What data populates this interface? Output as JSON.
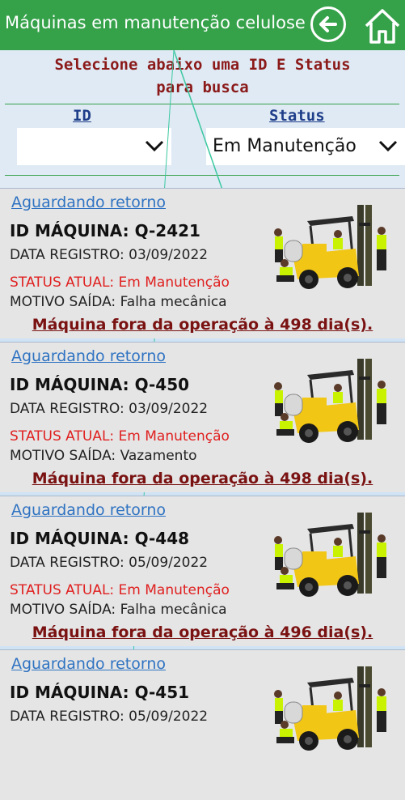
{
  "header": {
    "title": "Máquinas em manutenção celulose"
  },
  "filters": {
    "prompt_line1": "Selecione abaixo uma ID E Status",
    "prompt_line2": "para busca",
    "id_label": "ID",
    "status_label": "Status",
    "id_value": "",
    "status_value": "Em Manutenção"
  },
  "cards": [
    {
      "waiting": "Aguardando retorno",
      "machine_id": "ID MÁQUINA: Q-2421",
      "date": "DATA REGISTRO: 03/09/2022",
      "status": "STATUS ATUAL: Em Manutenção",
      "motivo_label": "MOTIVO SAÍDA: ",
      "motivo_value": "Falha mecânica",
      "days": "Máquina fora da operação à 498 dia(s)."
    },
    {
      "waiting": "Aguardando retorno",
      "machine_id": "ID MÁQUINA: Q-450",
      "date": "DATA REGISTRO: 03/09/2022",
      "status": "STATUS ATUAL: Em Manutenção",
      "motivo_label": "MOTIVO SAÍDA: ",
      "motivo_value": "Vazamento",
      "days": "Máquina fora da operação à 498 dia(s)."
    },
    {
      "waiting": "Aguardando retorno",
      "machine_id": "ID MÁQUINA: Q-448",
      "date": "DATA REGISTRO: 05/09/2022",
      "status": "STATUS ATUAL: Em Manutenção",
      "motivo_label": "MOTIVO SAÍDA: ",
      "motivo_value": "Falha mecânica",
      "days": "Máquina fora da operação à 496 dia(s)."
    },
    {
      "waiting": "Aguardando retorno",
      "machine_id": "ID MÁQUINA: Q-451",
      "date": "DATA REGISTRO: 05/09/2022",
      "status": "",
      "motivo_label": "",
      "motivo_value": "",
      "days": ""
    }
  ]
}
